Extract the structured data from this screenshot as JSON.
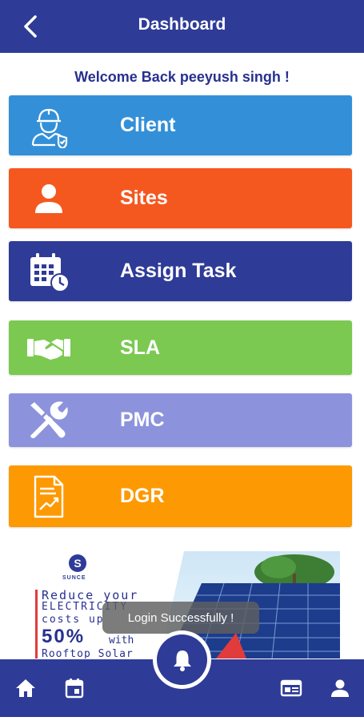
{
  "header": {
    "title": "Dashboard",
    "back_icon": "chevron-left-icon"
  },
  "welcome_text": "Welcome Back peeyush singh !",
  "tiles": [
    {
      "label": "Client",
      "icon": "engineer-icon",
      "color": "#3390d8"
    },
    {
      "label": "Sites",
      "icon": "person-icon",
      "color": "#f5581f"
    },
    {
      "label": "Assign Task",
      "icon": "calendar-clock-icon",
      "color": "#2e3b97"
    },
    {
      "label": "SLA",
      "icon": "handshake-icon",
      "color": "#7bc951"
    },
    {
      "label": "PMC",
      "icon": "tools-icon",
      "color": "#8c93dc"
    },
    {
      "label": "DGR",
      "icon": "report-icon",
      "color": "#fd9903"
    }
  ],
  "banner": {
    "logo": "SUNCE",
    "line1": "Reduce your",
    "line2": "ELECTRICITY",
    "line3": "costs up",
    "percent": "50%",
    "percent_suffix": "with",
    "line5": "Rooftop Solar"
  },
  "toast": "Login Successfully !",
  "bottom_nav": {
    "home_icon": "home-icon",
    "calendar_icon": "calendar-icon",
    "fab_icon": "bell-icon",
    "card_icon": "id-card-icon",
    "profile_icon": "person-icon"
  },
  "colors": {
    "primary": "#2e3b97",
    "accent_red": "#e23b3b"
  }
}
